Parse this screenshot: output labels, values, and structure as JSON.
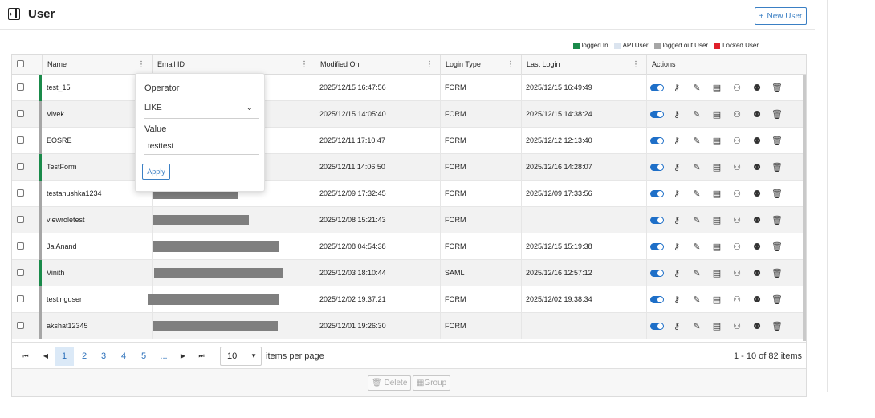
{
  "header": {
    "title": "User",
    "new_user_label": "New User",
    "new_user_icon": "plus-icon",
    "toggle_icon": "sidebar-toggle-icon"
  },
  "legend": [
    {
      "label": "logged In",
      "color": "#1a8a4a"
    },
    {
      "label": "API User",
      "color": "#dbe4ef"
    },
    {
      "label": "logged out User",
      "color": "#a6a6a6"
    },
    {
      "label": "Locked User",
      "color": "#e0202a"
    }
  ],
  "columns": {
    "name": "Name",
    "email": "Email ID",
    "modified": "Modified On",
    "login_type": "Login Type",
    "last_login": "Last Login",
    "actions": "Actions",
    "menu_icon": "⋮"
  },
  "rows": [
    {
      "name": "test_15",
      "modified": "2025/12/15 16:47:56",
      "login_type": "FORM",
      "last_login": "2025/12/15 16:49:49",
      "status_color": "#1a8a4a"
    },
    {
      "name": "Vivek",
      "modified": "2025/12/15 14:05:40",
      "login_type": "FORM",
      "last_login": "2025/12/15 14:38:24",
      "status_color": "#a6a6a6"
    },
    {
      "name": "EOSRE",
      "modified": "2025/12/11 17:10:47",
      "login_type": "FORM",
      "last_login": "2025/12/12 12:13:40",
      "status_color": "#a6a6a6"
    },
    {
      "name": "TestForm",
      "modified": "2025/12/11 14:06:50",
      "login_type": "FORM",
      "last_login": "2025/12/16 14:28:07",
      "status_color": "#1a8a4a"
    },
    {
      "name": "testanushka1234",
      "modified": "2025/12/09 17:32:45",
      "login_type": "FORM",
      "last_login": "2025/12/09 17:33:56",
      "status_color": "#a6a6a6"
    },
    {
      "name": "viewroletest",
      "modified": "2025/12/08 15:21:43",
      "login_type": "FORM",
      "last_login": "",
      "status_color": "#a6a6a6"
    },
    {
      "name": "JaiAnand",
      "modified": "2025/12/08 04:54:38",
      "login_type": "FORM",
      "last_login": "2025/12/15 15:19:38",
      "status_color": "#a6a6a6"
    },
    {
      "name": "Vinith",
      "modified": "2025/12/03 18:10:44",
      "login_type": "SAML",
      "last_login": "2025/12/16 12:57:12",
      "status_color": "#1a8a4a"
    },
    {
      "name": "testinguser",
      "modified": "2025/12/02 19:37:21",
      "login_type": "FORM",
      "last_login": "2025/12/02 19:38:34",
      "status_color": "#a6a6a6"
    },
    {
      "name": "akshat12345",
      "modified": "2025/12/01 19:26:30",
      "login_type": "FORM",
      "last_login": "",
      "status_color": "#a6a6a6"
    }
  ],
  "action_icons": [
    "toggle-switch",
    "key-icon",
    "edit-icon",
    "report-icon",
    "user-settings-icon",
    "user-group-icon",
    "trash-icon"
  ],
  "pager": {
    "pages": [
      "1",
      "2",
      "3",
      "4",
      "5",
      "..."
    ],
    "active_page": "1",
    "per_page": "10",
    "per_page_label": "items per page",
    "range_label": "1 - 10 of 82 items"
  },
  "footer": {
    "delete_label": "Delete",
    "group_label": "Group"
  },
  "filter_popup": {
    "operator_label": "Operator",
    "operator_value": "LIKE",
    "value_label": "Value",
    "value_input": "testtest",
    "apply_label": "Apply"
  }
}
